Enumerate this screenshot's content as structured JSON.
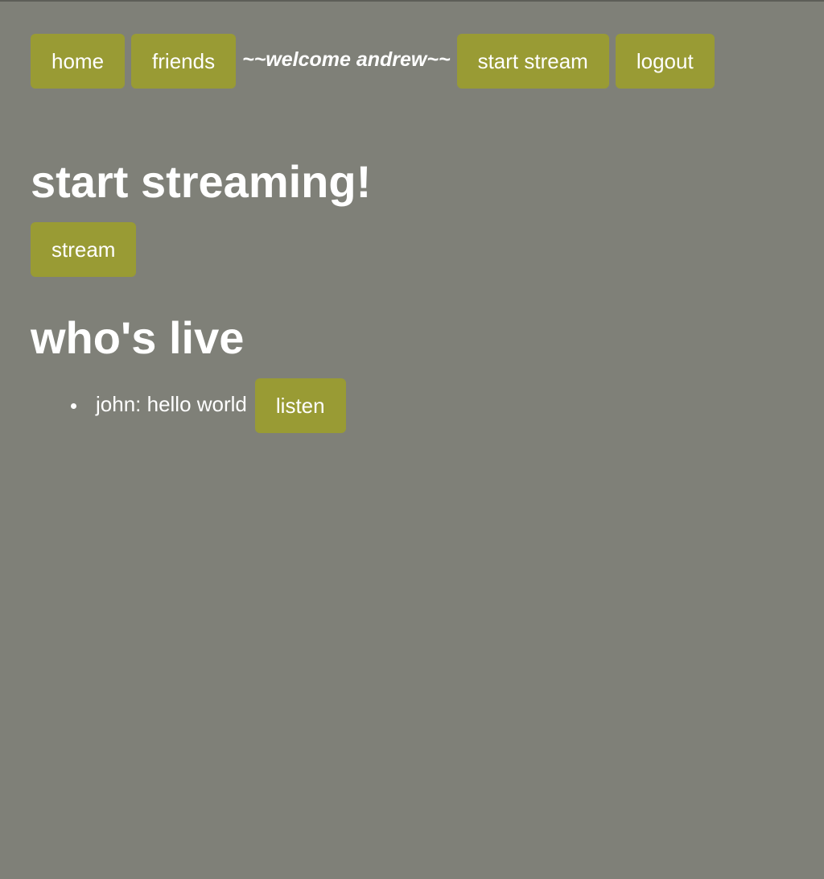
{
  "nav": {
    "home_label": "home",
    "friends_label": "friends",
    "welcome_text": "~~welcome andrew~~",
    "start_stream_label": "start stream",
    "logout_label": "logout"
  },
  "main": {
    "start_title": "start streaming!",
    "stream_button_label": "stream",
    "live_title": "who's live",
    "live_streams": [
      {
        "text": "john: hello world",
        "action_label": "listen"
      }
    ]
  },
  "colors": {
    "background": "#7f8078",
    "button": "#999b34",
    "text": "#ffffff"
  },
  "icons": {
    "list_marker": "bullet-icon"
  }
}
